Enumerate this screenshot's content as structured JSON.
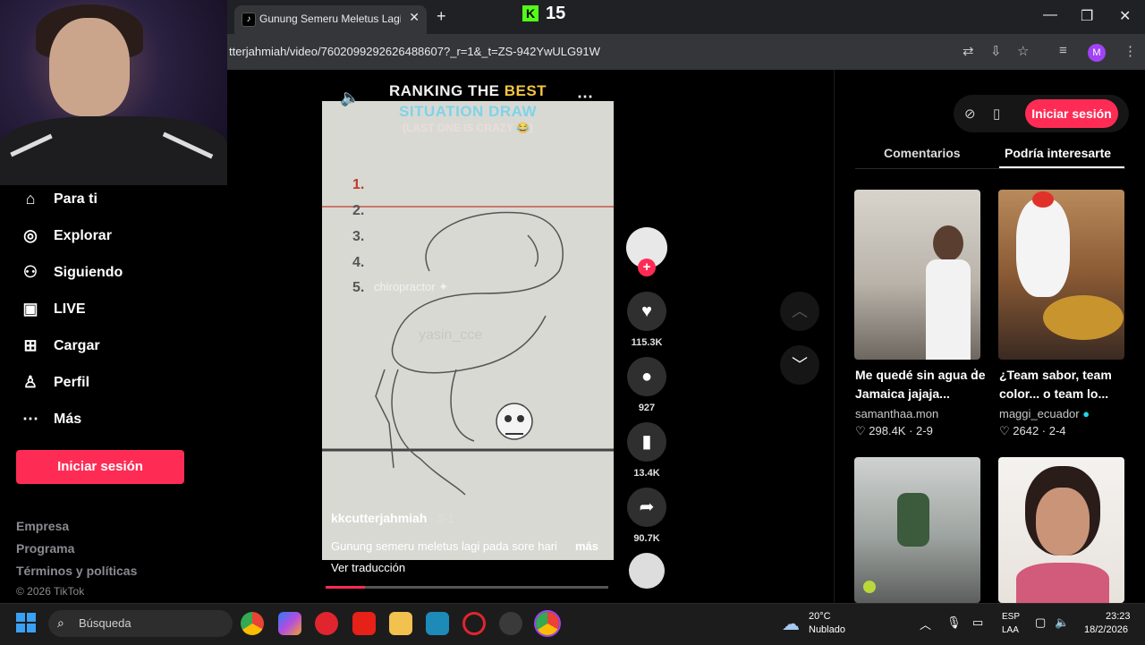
{
  "browser": {
    "tab_title": "Gunung Semeru Meletus Lagi p",
    "tab_close": "✕",
    "new_tab": "+",
    "url": "tterjahmiah/video/7602099292626488607?_r=1&_t=ZS-942YwULG91W",
    "profile_initial": "M",
    "window_controls": [
      "—",
      "❐",
      "✕"
    ]
  },
  "overlay": {
    "kick_logo": "K",
    "viewer_count": "15"
  },
  "sidebar": {
    "items": [
      {
        "icon": "home-icon",
        "label": "Para ti"
      },
      {
        "icon": "compass-icon",
        "label": "Explorar"
      },
      {
        "icon": "following-icon",
        "label": "Siguiendo"
      },
      {
        "icon": "live-icon",
        "label": "LIVE"
      },
      {
        "icon": "upload-icon",
        "label": "Cargar"
      },
      {
        "icon": "profile-icon",
        "label": "Perfil"
      },
      {
        "icon": "more-icon",
        "label": "Más"
      }
    ],
    "login_button": "Iniciar sesión",
    "footer": [
      "Empresa",
      "Programa",
      "Términos y políticas"
    ],
    "copyright": "© 2026 TikTok"
  },
  "video": {
    "title_line1_a": "RANKING THE ",
    "title_line1_b": "BEST",
    "title_line2": "SITUATION DRAW",
    "title_line3": "(LAST ONE IS CRAZY 😂)",
    "ranks": [
      "1.",
      "2.",
      "3.",
      "4.",
      "5."
    ],
    "rank5_label": "chiropractor ✦",
    "watermark": "yasin_cce",
    "author": "kkcutterjahmiah",
    "date": " · 2-1",
    "caption": "Gunung semeru meletus lagi pada sore hari",
    "more": "más",
    "translate": "Ver traducción",
    "progress": 0.14
  },
  "actions": {
    "likes": "115.3K",
    "comments": "927",
    "saves": "13.4K",
    "shares": "90.7K"
  },
  "right_panel": {
    "login": "Iniciar sesión",
    "tab_comments": "Comentarios",
    "tab_interest": "Podría interesarte",
    "cards": [
      {
        "title": "Me quedé sin agua de Jamaica jajaja...",
        "author": "samanthaa.mon",
        "stats": "♡ 298.4K · 2-9"
      },
      {
        "title": "¿Team sabor, team color... o team lo...",
        "author": "maggi_ecuador",
        "stats": "♡ 2642 · 2-4"
      }
    ]
  },
  "taskbar": {
    "search_placeholder": "Búsqueda",
    "temperature": "20°C",
    "condition": "Nublado",
    "lang1": "ESP",
    "lang2": "LAA",
    "time": "23:23",
    "date": "18/2/2026"
  },
  "colors": {
    "accent": "#fe2c55",
    "kick_green": "#53fc18"
  }
}
